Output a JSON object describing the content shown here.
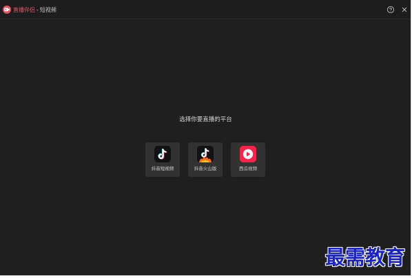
{
  "window": {
    "app_name": "直播伴侣",
    "separator": "-",
    "mode": "短视频"
  },
  "titlebar": {
    "help_icon": "question-circle-icon",
    "close_icon": "close-x-icon"
  },
  "main": {
    "heading": "选择你要直播的平台",
    "platforms": [
      {
        "label": "抖音短视频",
        "icon": "douyin-icon"
      },
      {
        "label": "抖音火山版",
        "icon": "douyin-huoshan-icon"
      },
      {
        "label": "西瓜视频",
        "icon": "xigua-icon"
      }
    ]
  },
  "watermark": {
    "text": "最需教育"
  },
  "colors": {
    "background": "#1f1f20",
    "card": "#323233",
    "app_name": "#e15a68",
    "watermark": "#1a23c8"
  }
}
